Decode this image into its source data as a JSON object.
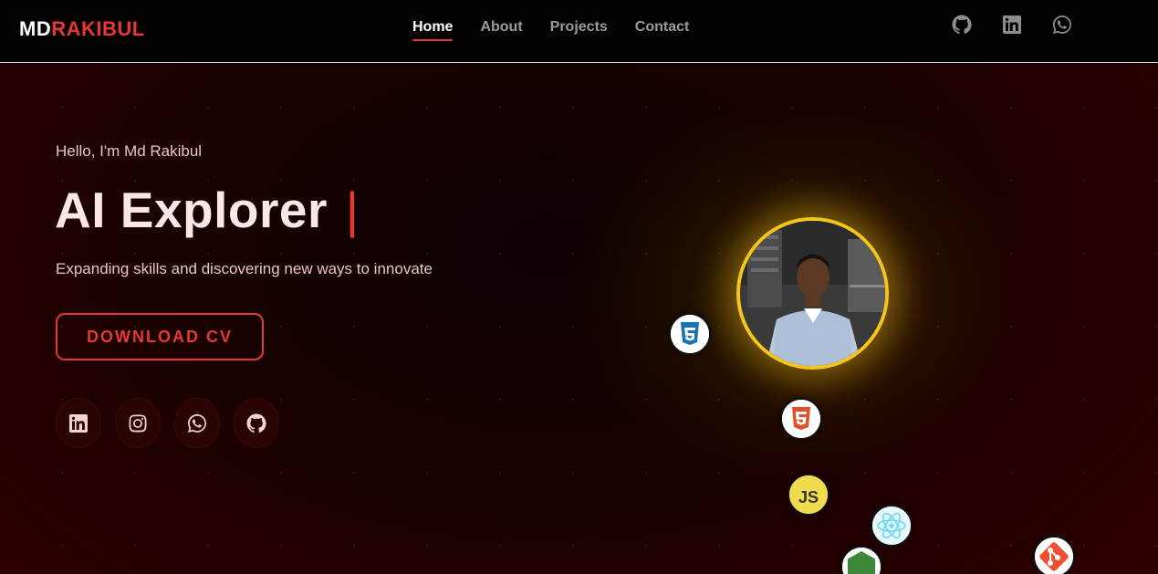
{
  "header": {
    "logo_a": "MD",
    "logo_b": "RAKIBUL",
    "nav": [
      {
        "label": "Home",
        "active": true
      },
      {
        "label": "About",
        "active": false
      },
      {
        "label": "Projects",
        "active": false
      },
      {
        "label": "Contact",
        "active": false
      }
    ],
    "icons": [
      "github-icon",
      "linkedin-icon",
      "whatsapp-icon"
    ]
  },
  "hero": {
    "greeting": "Hello, I'm Md Rakibul",
    "title": "AI Explorer",
    "cursor": "|",
    "subtitle": "Expanding skills and discovering new ways to innovate",
    "cta_label": "DOWNLOAD CV",
    "socials": [
      "linkedin-icon",
      "instagram-icon",
      "whatsapp-icon",
      "github-icon"
    ]
  },
  "tech_icons": [
    "css3-icon",
    "html5-icon",
    "javascript-icon",
    "react-icon",
    "nodejs-icon",
    "git-icon"
  ],
  "colors": {
    "accent": "#e53935",
    "avatar_ring": "#f5c518",
    "background_dark": "#050101",
    "background_red": "#3a0000"
  }
}
